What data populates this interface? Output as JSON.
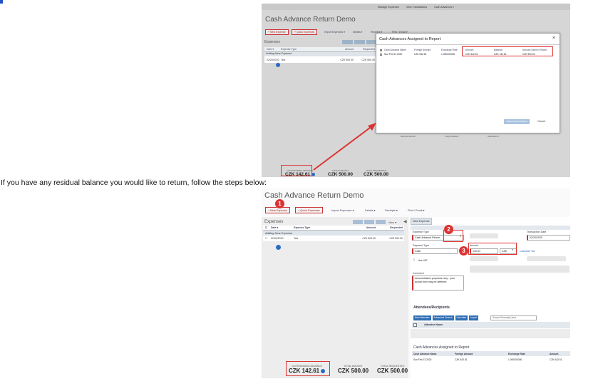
{
  "caption": "If you have any residual balance you would like to return, follow the steps below:",
  "shot1": {
    "nav": [
      "Manage Expenses",
      "View Transactions",
      "Cash Advances ▾"
    ],
    "title": "Cash Advance Return Demo",
    "buttons": [
      "+ New Expense",
      "+ Quick Expenses"
    ],
    "links": [
      "Import Expenses ▾",
      "Details ▾",
      "Receipts ▾",
      "Print / Email ▾"
    ],
    "expenses_label": "Expenses",
    "table_headers": [
      "Date ▾",
      "Expense Type",
      "Amount",
      "Requested"
    ],
    "adding_label": "Adding New Expense",
    "row": {
      "date": "02/20/2020",
      "type": "Taxi",
      "amount": "CZK 500.00",
      "requested": "CZK 500.00"
    },
    "modal": {
      "title": "Cash Advances Assigned to Report",
      "close": "×",
      "headers": [
        "Cash Advance Name",
        "Foreign Amount",
        "Exchange Rate",
        "Amount",
        "Balance",
        "Amount Used in Report"
      ],
      "row": [
        "Sun Feb 23 2020",
        "CZK 642.61",
        "1.000000000",
        "CZK 642.61",
        "CZK 142.61",
        "CZK 500.00"
      ],
      "submit": "Submit Cash Advance",
      "cancel": "Cancel"
    },
    "under_labels": [
      "Reimbursement",
      "Long Distance",
      "Attendees ▾"
    ],
    "summary": {
      "outstanding_label": "OUTSTANDING ADVANCE",
      "outstanding_value": "CZK 142.61",
      "total_label": "TOTAL AMOUNT",
      "total_value": "CZK 500.00",
      "requested_label": "TOTAL REQUESTED",
      "requested_value": "CZK 500.00"
    }
  },
  "shot2": {
    "title": "Cash Advance Return Demo",
    "buttons": [
      "+ New Expense",
      "+ Quick Expenses"
    ],
    "links": [
      "Import Expenses ▾",
      "Details ▾",
      "Receipts ▾",
      "Print / Email ▾"
    ],
    "expenses_label": "Expenses",
    "view_label": "View ▾",
    "table_headers": [
      "Date ▾",
      "Expense Type",
      "Amount",
      "Requested"
    ],
    "adding_label": "Adding New Expense",
    "row": {
      "date": "02/20/2020",
      "type": "Taxi",
      "amount": "CZK 500.00",
      "requested": "CZK 500.00"
    },
    "tab": "New Expense",
    "form": {
      "expense_type_label": "Expense Type",
      "expense_type_value": "Cash Advance Return",
      "transaction_date_label": "Transaction Date",
      "transaction_date_value": "02/20/2020",
      "payment_type_label": "Payment Type",
      "payment_type_value": "Cash",
      "amount_label": "Amount",
      "amount_value": "142.61",
      "currency_value": "CZK",
      "calculate_label": "Calculate Tax",
      "has_vat_label": "Has VAT",
      "comment_label": "Comment",
      "comment_value": "demonstration purposes only - your actual form may be different"
    },
    "badges": [
      "1",
      "2",
      "3"
    ],
    "attendees": {
      "title": "Attendees/Recipients",
      "buttons": [
        "New Attendee",
        "Advanced Search",
        "Favorites",
        "Import"
      ],
      "search_placeholder": "Search Recently Used",
      "column": "Attendee Name"
    },
    "cash_advances": {
      "title": "Cash Advances Assigned to Report",
      "headers": [
        "Cash Advance Name",
        "Foreign Amount",
        "Exchange Rate",
        "Amount"
      ],
      "row": [
        "Sun Feb 23 2020",
        "CZK 642.61",
        "1.000000000",
        "CZK 642.61"
      ]
    },
    "summary": {
      "outstanding_label": "OUTSTANDING ADVANCE",
      "outstanding_value": "CZK 142.61",
      "total_label": "TOTAL AMOUNT",
      "total_value": "CZK 500.00",
      "requested_label": "TOTAL REQUESTED",
      "requested_value": "CZK 500.00"
    }
  },
  "colors": {
    "highlight": "#dd3333",
    "accent": "#2d6ac4",
    "bullet": "#2350c8"
  }
}
